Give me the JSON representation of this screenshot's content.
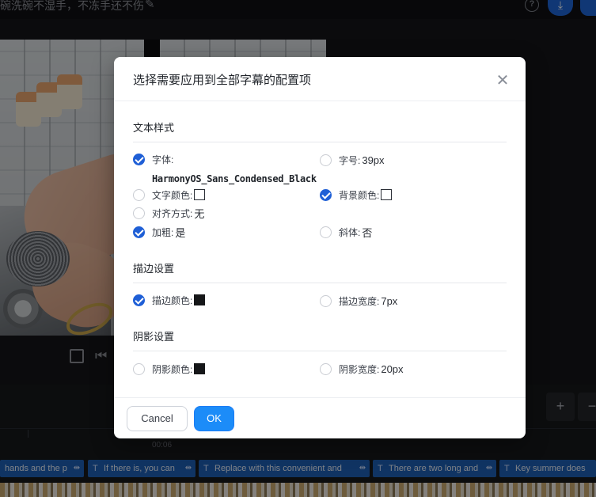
{
  "editor": {
    "project_title": "碗洗碗不湿手，不冻手还不伤",
    "timeline_time": "00:06",
    "clips": [
      {
        "label": "hands and the p"
      },
      {
        "label": "If there is, you can"
      },
      {
        "label": "Replace with this convenient and"
      },
      {
        "label": "There are two long and"
      },
      {
        "label": "Key summer does"
      }
    ]
  },
  "dialog": {
    "title": "选择需要应用到全部字幕的配置项",
    "sections": {
      "text_style": "文本样式",
      "stroke": "描边设置",
      "shadow": "阴影设置"
    },
    "options": {
      "font": {
        "label": "字体:",
        "checked": true,
        "value": "HarmonyOS_Sans_Condensed_Black"
      },
      "font_size": {
        "label": "字号:",
        "checked": false,
        "value": "39px"
      },
      "text_color": {
        "label": "文字颜色:",
        "checked": false,
        "swatch": "#ffffff"
      },
      "bg_color": {
        "label": "背景颜色:",
        "checked": true,
        "swatch": "#ffffff"
      },
      "align": {
        "label": "对齐方式:",
        "checked": false,
        "value": "无"
      },
      "bold": {
        "label": "加粗:",
        "checked": true,
        "value": "是"
      },
      "italic": {
        "label": "斜体:",
        "checked": false,
        "value": "否"
      },
      "stroke_color": {
        "label": "描边颜色:",
        "checked": true,
        "swatch": "#161719"
      },
      "stroke_width": {
        "label": "描边宽度:",
        "checked": false,
        "value": "7px"
      },
      "shadow_color": {
        "label": "阴影颜色:",
        "checked": false,
        "swatch": "#161719"
      },
      "shadow_width": {
        "label": "阴影宽度:",
        "checked": false,
        "value": "20px"
      }
    },
    "buttons": {
      "cancel": "Cancel",
      "ok": "OK"
    }
  },
  "colors": {
    "accent": "#1c8cf8",
    "checkbox_on": "#1f5fd6",
    "clip": "#1e5fb4"
  }
}
